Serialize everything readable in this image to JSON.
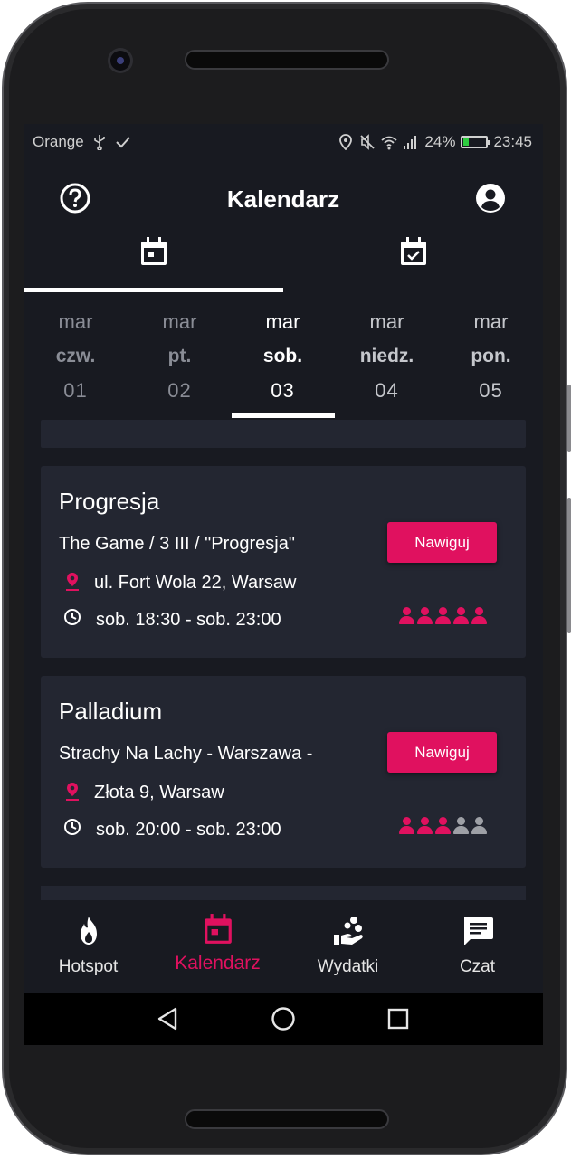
{
  "status_bar": {
    "carrier": "Orange",
    "battery": "24%",
    "time": "23:45"
  },
  "header": {
    "title": "Kalendarz",
    "help_icon": "help-circle-icon",
    "account_icon": "account-circle-icon"
  },
  "tabs": [
    {
      "icon": "calendar-icon",
      "selected": true
    },
    {
      "icon": "calendar-check-icon",
      "selected": false
    }
  ],
  "days": [
    {
      "month": "mar",
      "weekday": "czw.",
      "day": "01"
    },
    {
      "month": "mar",
      "weekday": "pt.",
      "day": "02"
    },
    {
      "month": "mar",
      "weekday": "sob.",
      "day": "03"
    },
    {
      "month": "mar",
      "weekday": "niedz.",
      "day": "04"
    },
    {
      "month": "mar",
      "weekday": "pon.",
      "day": "05"
    }
  ],
  "selected_day_index": 2,
  "events": [
    {
      "venue": "Progresja",
      "event": "The Game / 3 III / \"Progresja\"",
      "address": "ul. Fort Wola 22, Warsaw",
      "time": "sob. 18:30 - sob. 23:00",
      "navigate_label": "Nawiguj",
      "attendance": 5,
      "attendance_max": 5
    },
    {
      "venue": "Palladium",
      "event": "Strachy Na Lachy - Warszawa -",
      "address": "Złota 9, Warsaw",
      "time": "sob. 20:00 - sob. 23:00",
      "navigate_label": "Nawiguj",
      "attendance": 3,
      "attendance_max": 5
    }
  ],
  "bottom_nav": [
    {
      "label": "Hotspot",
      "icon": "flame-icon",
      "active": false
    },
    {
      "label": "Kalendarz",
      "icon": "calendar-icon",
      "active": true
    },
    {
      "label": "Wydatki",
      "icon": "hand-coins-icon",
      "active": false
    },
    {
      "label": "Czat",
      "icon": "chat-icon",
      "active": false
    }
  ],
  "colors": {
    "accent": "#e0115f",
    "background": "#181a21",
    "card": "#232631",
    "inactive_person": "#9ea0a6"
  }
}
